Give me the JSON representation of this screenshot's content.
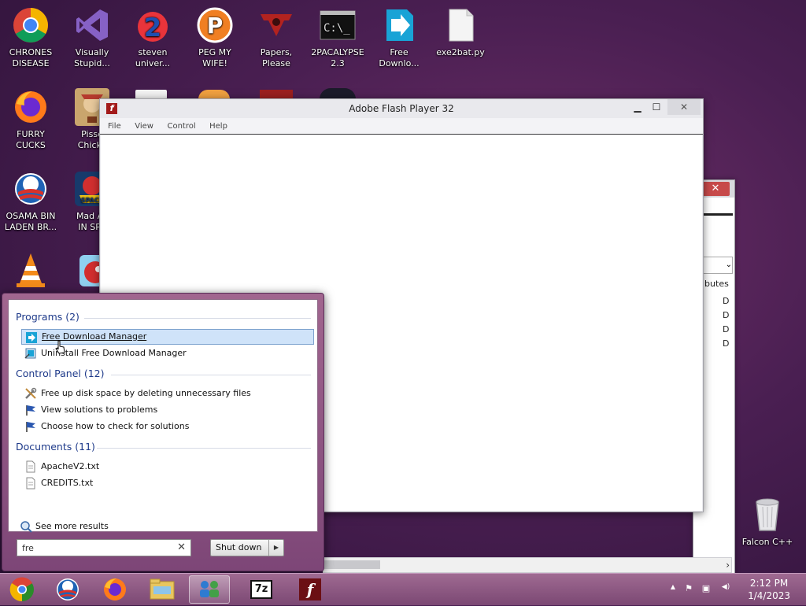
{
  "desktop": {
    "icons": [
      {
        "label": "CHRONES\nDISEASE",
        "icon": "chrome-icon"
      },
      {
        "label": "Visually\nStupid...",
        "icon": "visual-studio-icon"
      },
      {
        "label": "steven\nuniver...",
        "icon": "steven-universe-icon"
      },
      {
        "label": "PEG MY WIFE!",
        "icon": "peggle-icon"
      },
      {
        "label": "Papers,\nPlease",
        "icon": "papers-please-icon"
      },
      {
        "label": "2PACALYPSE\n2.3",
        "icon": "cmd-icon"
      },
      {
        "label": "Free\nDownlo...",
        "icon": "fdm-icon"
      },
      {
        "label": "exe2bat.py",
        "icon": "file-icon"
      },
      {
        "label": "FURRY CUCKS",
        "icon": "firefox-icon"
      },
      {
        "label": "Pisse\nChicke",
        "icon": "chicken-game-icon"
      },
      {
        "label": "OSAMA BIN\nLADEN BR...",
        "icon": "obama-logo-icon"
      },
      {
        "label": "Mad Av\nIN SPA",
        "icon": "angry-birds-space-icon"
      },
      {
        "label": "",
        "icon": "vlc-icon"
      },
      {
        "label": "",
        "icon": "angry-birds-icon"
      },
      {
        "label": "Falcon C++",
        "icon": "recycle-bin-icon"
      }
    ]
  },
  "flash_window": {
    "title": "Adobe Flash Player 32",
    "logo_glyph": "f",
    "minimize": "▁",
    "maximize": "☐",
    "close": "✕",
    "menu": [
      "File",
      "View",
      "Control",
      "Help"
    ]
  },
  "back_window": {
    "close": "✕",
    "dropdown_arrow": "⌄",
    "column_header": "ibutes",
    "values": [
      "D",
      "D",
      "D",
      "D"
    ]
  },
  "scrollbar": {
    "right_arrow": "›"
  },
  "start_menu": {
    "sections": [
      {
        "heading": "Programs (2)",
        "items": [
          {
            "label": "Free Download Manager",
            "icon": "fdm-icon",
            "highlighted": true
          },
          {
            "label": "Uninstall Free Download Manager",
            "icon": "uninstall-icon",
            "highlighted": false
          }
        ]
      },
      {
        "heading": "Control Panel (12)",
        "items": [
          {
            "label": "Free up disk space by deleting unnecessary files",
            "icon": "tools-icon",
            "highlighted": false
          },
          {
            "label": "View solutions to problems",
            "icon": "flag-icon",
            "highlighted": false
          },
          {
            "label": "Choose how to check for solutions",
            "icon": "flag-icon",
            "highlighted": false
          }
        ]
      },
      {
        "heading": "Documents (11)",
        "items": [
          {
            "label": "ApacheV2.txt",
            "icon": "text-file-icon",
            "highlighted": false
          },
          {
            "label": "CREDITS.txt",
            "icon": "text-file-icon",
            "highlighted": false
          }
        ]
      }
    ],
    "see_more": "See more results",
    "search_value": "fre",
    "search_clear": "✕",
    "shutdown_label": "Shut down",
    "shutdown_arrow": "▶"
  },
  "taskbar": {
    "buttons": [
      "start-orb-icon",
      "obama-logo-icon",
      "firefox-icon",
      "file-explorer-icon",
      "network-users-icon",
      "7zip-icon",
      "flash-icon"
    ],
    "active_index": 4,
    "sevenzip_text": "7z",
    "flash_text": "f",
    "tray_icons": [
      "▲",
      "⚑",
      "▣",
      "◀)"
    ],
    "time": "2:12 PM",
    "date": "1/4/2023"
  },
  "colors": {
    "accent": "#1e3a8a",
    "highlight": "#cfe3f9",
    "taskbar": "#8c5482"
  }
}
